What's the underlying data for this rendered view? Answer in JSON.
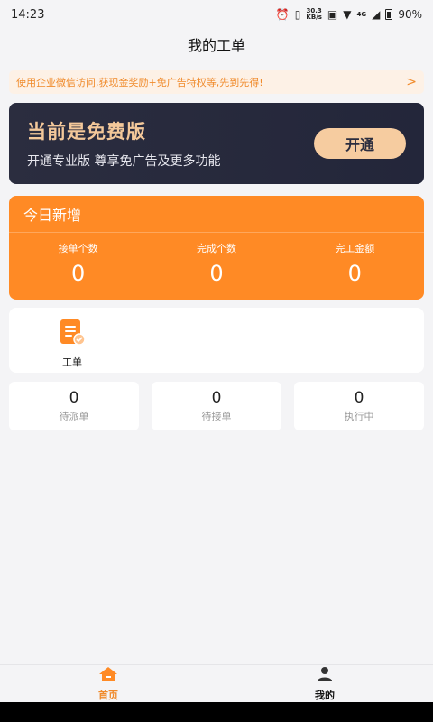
{
  "status_bar": {
    "time": "14:23",
    "net_speed_top": "30.3",
    "net_speed_bottom": "KB/s",
    "signal": "4G",
    "battery": "90%"
  },
  "header": {
    "title": "我的工单"
  },
  "notice": {
    "text": "使用企业微信访问,获现金奖励+免广告特权等,先到先得!",
    "arrow": ">"
  },
  "upgrade": {
    "title": "当前是免费版",
    "subtitle": "开通专业版 尊享免广告及更多功能",
    "button": "开通"
  },
  "today": {
    "title": "今日新增",
    "stats": [
      {
        "label": "接单个数",
        "value": "0"
      },
      {
        "label": "完成个数",
        "value": "0"
      },
      {
        "label": "完工金额",
        "value": "0"
      }
    ]
  },
  "tools": [
    {
      "label": "工单",
      "icon": "work-order-icon"
    }
  ],
  "counts": [
    {
      "value": "0",
      "label": "待派单"
    },
    {
      "value": "0",
      "label": "待接单"
    },
    {
      "value": "0",
      "label": "执行中"
    }
  ],
  "tabbar": [
    {
      "label": "首页",
      "icon": "home-icon",
      "active": true
    },
    {
      "label": "我的",
      "icon": "user-icon",
      "active": false
    }
  ],
  "colors": {
    "accent": "#ff8a25",
    "dark_card": "#2b2d3f",
    "gold": "#f3c89a"
  }
}
